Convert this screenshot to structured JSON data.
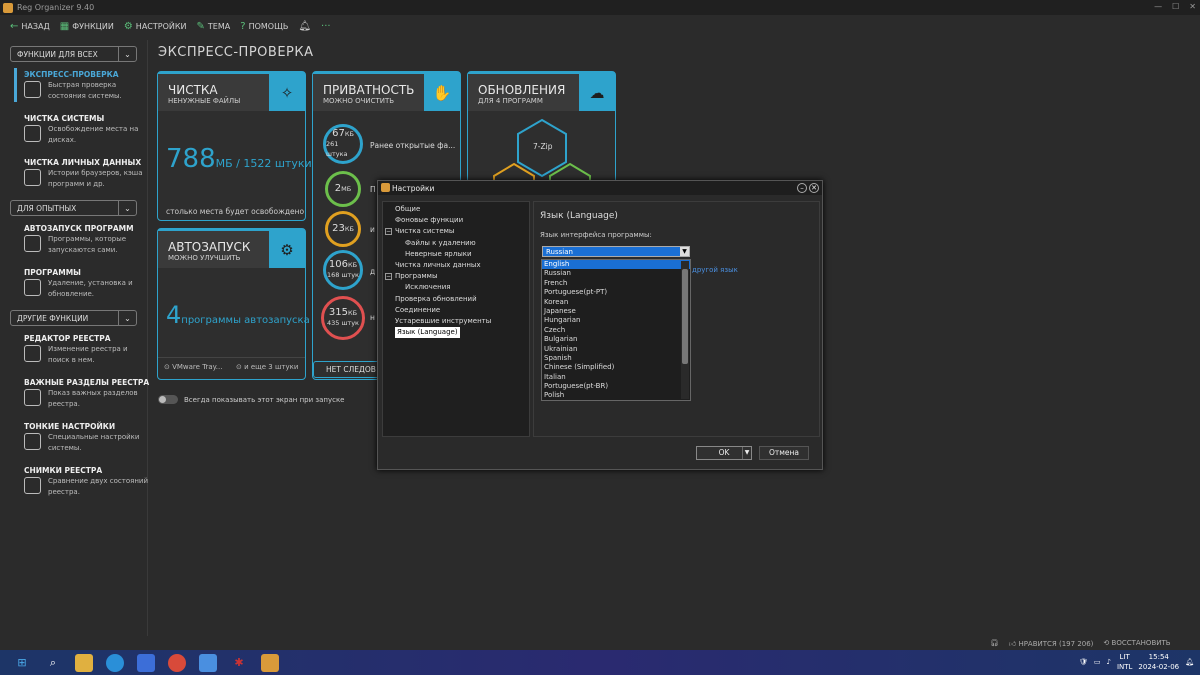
{
  "window": {
    "title": "Reg Organizer 9.40"
  },
  "toolbar": {
    "back": "НАЗАД",
    "functions": "ФУНКЦИИ",
    "settings": "НАСТРОЙКИ",
    "theme": "ТЕМА",
    "help": "ПОМОЩЬ",
    "more": "···"
  },
  "sidebar": {
    "sec1": "ФУНКЦИИ ДЛЯ ВСЕХ",
    "sec2": "ДЛЯ ОПЫТНЫХ",
    "sec3": "ДРУГИЕ ФУНКЦИИ",
    "items": [
      {
        "title": "ЭКСПРЕСС-ПРОВЕРКА",
        "desc": "Быстрая проверка состояния системы."
      },
      {
        "title": "ЧИСТКА СИСТЕМЫ",
        "desc": "Освобождение места на дисках."
      },
      {
        "title": "ЧИСТКА ЛИЧНЫХ ДАННЫХ",
        "desc": "Истории браузеров, кэша программ и др."
      },
      {
        "title": "АВТОЗАПУСК ПРОГРАММ",
        "desc": "Программы, которые запускаются сами."
      },
      {
        "title": "ПРОГРАММЫ",
        "desc": "Удаление, установка и обновление."
      },
      {
        "title": "РЕДАКТОР РЕЕСТРА",
        "desc": "Изменение реестра и поиск в нем."
      },
      {
        "title": "ВАЖНЫЕ РАЗДЕЛЫ РЕЕСТРА",
        "desc": "Показ важных разделов реестра."
      },
      {
        "title": "ТОНКИЕ НАСТРОЙКИ",
        "desc": "Специальные настройки системы."
      },
      {
        "title": "СНИМКИ РЕЕСТРА",
        "desc": "Сравнение двух состояний реестра."
      }
    ]
  },
  "main": {
    "title": "ЭКСПРЕСС-ПРОВЕРКА",
    "clean": {
      "title": "ЧИСТКА",
      "sub": "НЕНУЖНЫЕ ФАЙЛЫ",
      "big": "788",
      "unit": "МБ / 1522 штуки",
      "note": "столько места будет освобождено"
    },
    "privacy": {
      "title": "ПРИВАТНОСТЬ",
      "sub": "МОЖНО ОЧИСТИТЬ",
      "rows": [
        {
          "val": "67",
          "unit": "КБ",
          "count": "261 штука",
          "label": "Ранее открытые фа..."
        },
        {
          "val": "2",
          "unit": "МБ",
          "count": "",
          "label": "П"
        },
        {
          "val": "23",
          "unit": "КБ",
          "count": "",
          "label": "и"
        },
        {
          "val": "106",
          "unit": "КБ",
          "count": "168 штук",
          "label": "д"
        },
        {
          "val": "315",
          "unit": "КБ",
          "count": "435 штук",
          "label": "н"
        }
      ],
      "button": "НЕТ СЛЕДОВ"
    },
    "updates": {
      "title": "ОБНОВЛЕНИЯ",
      "sub": "ДЛЯ 4 ПРОГРАММ",
      "app": "7-Zip"
    },
    "autorun": {
      "title": "АВТОЗАПУСК",
      "sub": "МОЖНО УЛУЧШИТЬ",
      "big": "4",
      "unit": "программы автозапуска",
      "item1": "VMware Tray...",
      "item2": "и еще 3 штуки"
    },
    "toggle_label": "Всегда показывать этот экран при запуске"
  },
  "dialog": {
    "title": "Настройки",
    "tree": [
      "Общие",
      "Фоновые функции",
      "Чистка системы",
      "Файлы к удалению",
      "Неверные ярлыки",
      "Чистка личных данных",
      "Программы",
      "Исключения",
      "Проверка обновлений",
      "Соединение",
      "Устаревшие инструменты",
      "Язык (Language)"
    ],
    "section": "Язык (Language)",
    "label": "Язык интерфейса программы:",
    "selected": "Russian",
    "link_fragment": "другой язык",
    "options": [
      "English",
      "Russian",
      "French",
      "Portuguese(pt-PT)",
      "Korean",
      "Japanese",
      "Hungarian",
      "Czech",
      "Bulgarian",
      "Ukrainian",
      "Spanish",
      "Chinese (Simplified)",
      "Italian",
      "Portuguese(pt-BR)",
      "Polish"
    ],
    "ok": "OK",
    "cancel": "Отмена"
  },
  "status": {
    "likes": "НРАВИТСЯ (197 206)",
    "restore": "ВОССТАНОВИТЬ"
  },
  "tray": {
    "lang1": "LIT",
    "lang2": "INTL",
    "time": "15:54",
    "date": "2024-02-06"
  }
}
